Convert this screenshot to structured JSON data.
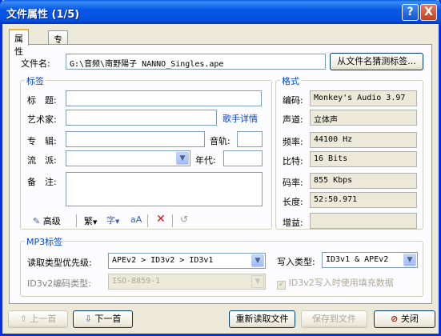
{
  "window": {
    "title": "文件属性 (1/5)",
    "help": "?",
    "close": "X"
  },
  "tabs": [
    "属性",
    "专辑封面"
  ],
  "filename": {
    "label": "文件名:",
    "value": "G:\\音频\\南野陽子 NANNO_Singles.ape",
    "guess_button": "从文件名猜测标签..."
  },
  "tag_group": {
    "label": "标签",
    "title_label": "标　题:",
    "artist_label": "艺术家:",
    "artist_link": "歌手详情",
    "album_label": "专　辑:",
    "track_label": "音轨:",
    "genre_label": "流　派:",
    "year_label": "年代:",
    "comment_label": "备　注:",
    "toolbar": {
      "advanced": "高级",
      "trad": "繁"
    }
  },
  "format_group": {
    "label": "格式",
    "rows": [
      {
        "label": "编码:",
        "value": "Monkey's Audio 3.97"
      },
      {
        "label": "声道:",
        "value": "立体声"
      },
      {
        "label": "频率:",
        "value": "44100 Hz"
      },
      {
        "label": "比特:",
        "value": "16 Bits"
      },
      {
        "label": "码率:",
        "value": "855 Kbps"
      },
      {
        "label": "长度:",
        "value": "52:50.971"
      },
      {
        "label": "增益:",
        "value": ""
      }
    ]
  },
  "mp3_group": {
    "label": "MP3标签",
    "read_priority_label": "读取类型优先级:",
    "read_priority_value": "APEv2 > ID3v2 > ID3v1",
    "write_type_label": "写入类型:",
    "write_type_value": "ID3v1 & APEv2",
    "encoding_label": "ID3v2编码类型:",
    "encoding_value": "ISO-8859-1",
    "padding_label": "ID3v2写入时使用填充数据"
  },
  "footer": {
    "prev": "上一首",
    "next": "下一首",
    "reread": "重新读取文件",
    "save": "保存到文件",
    "close": "关闭"
  },
  "colors": {
    "title_blue": "#0758e6",
    "group_label": "#0046d5",
    "link": "#0046d5"
  }
}
